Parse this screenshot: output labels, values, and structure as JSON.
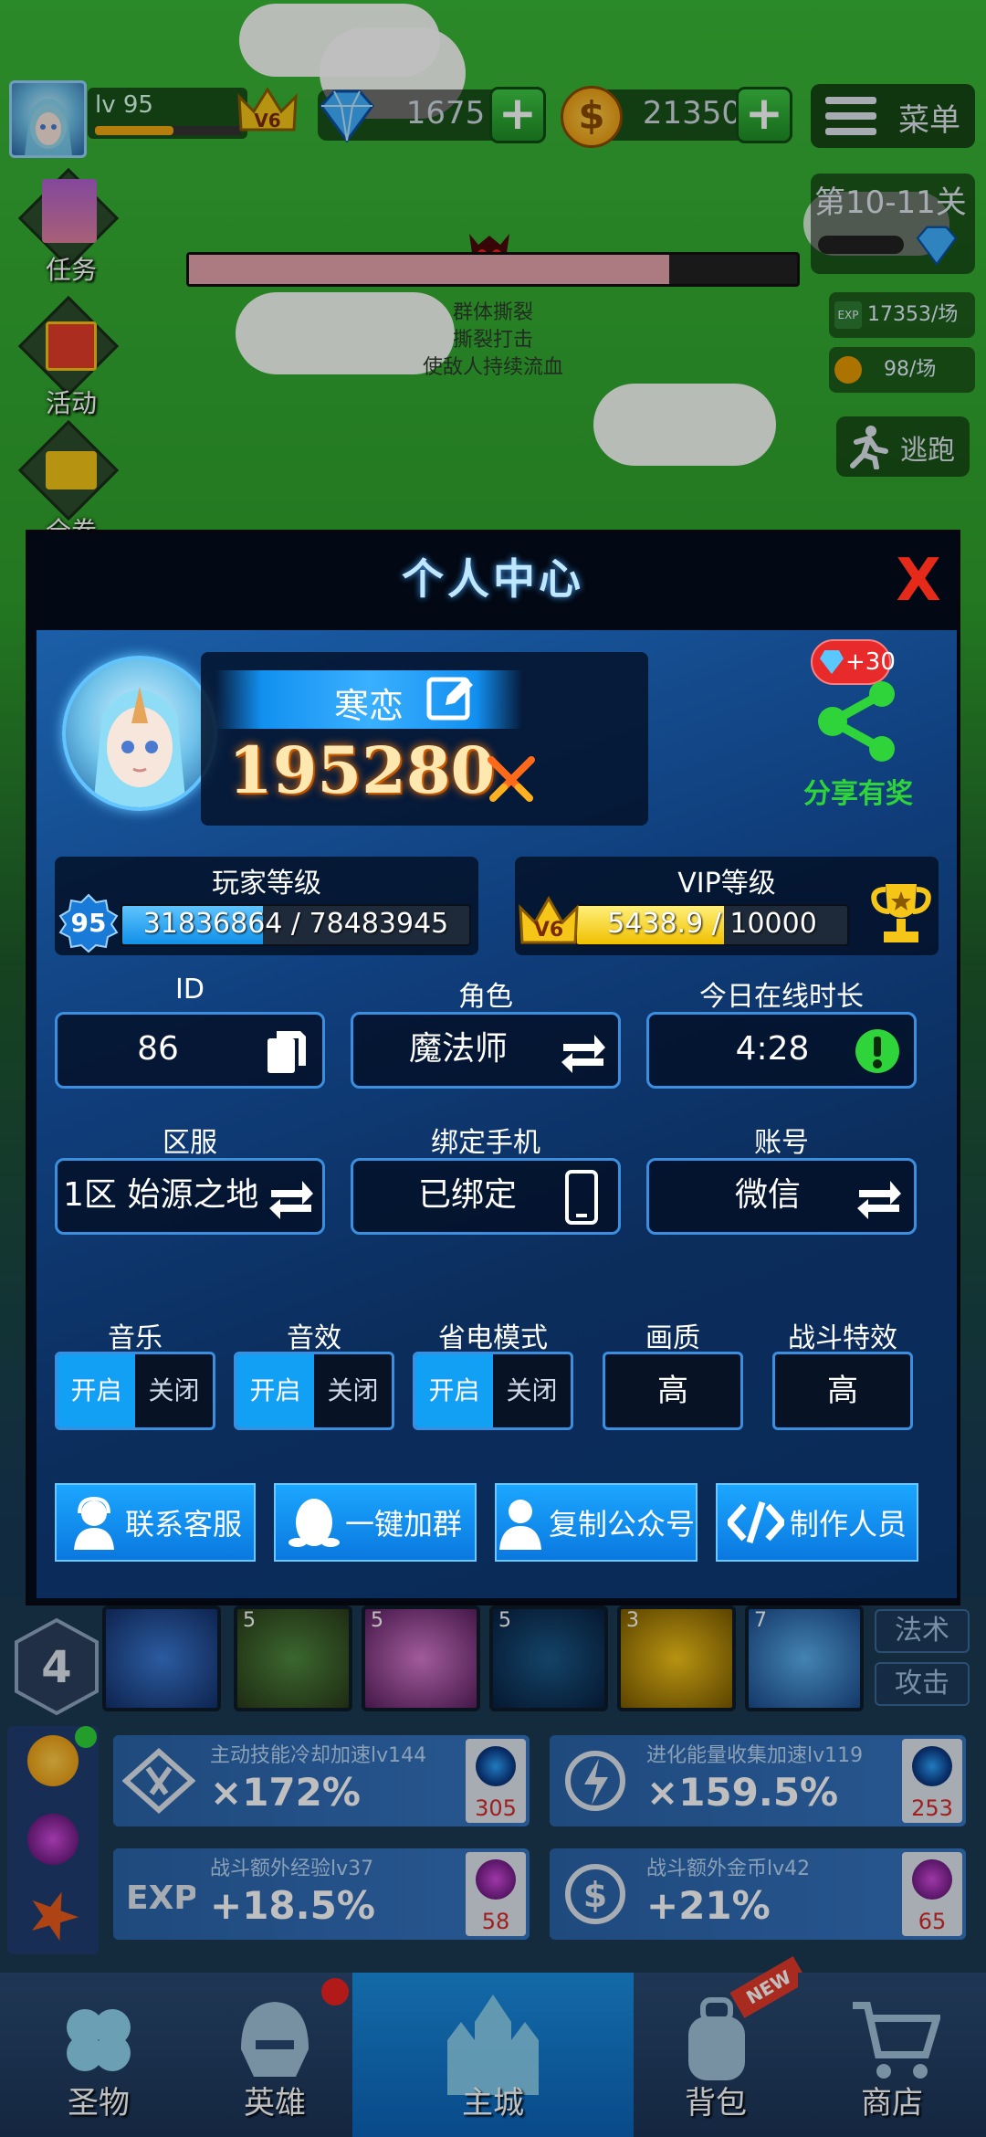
{
  "top": {
    "player_level": "lv 95",
    "vip_badge": "V6",
    "diamonds": "1675",
    "gold": "21350",
    "menu_label": "菜单",
    "stage": "第10-11关",
    "exp_rate": "17353/场",
    "gold_rate": "98/场",
    "escape_label": "逃跑",
    "skill_lines": [
      "群体撕裂",
      "撕裂打击",
      "使敌人持续流血"
    ],
    "boss_hp_fraction": 0.79
  },
  "side": {
    "items": [
      {
        "label": "任务",
        "icon": "task-icon"
      },
      {
        "label": "活动",
        "icon": "gift-icon"
      },
      {
        "label": "全卷",
        "icon": "coupon-icon"
      }
    ]
  },
  "modal": {
    "title": "个人中心",
    "close": "X",
    "name": "寒恋",
    "power": "195280",
    "share_reward": "+30",
    "share_label": "分享有奖",
    "player_level_title": "玩家等级",
    "player_level_badge": "95",
    "player_exp": "31836864 / 78483945",
    "player_exp_fraction": 0.405,
    "vip_title": "VIP等级",
    "vip_badge": "V6",
    "vip_points": "5438.9 / 10000",
    "vip_fraction": 0.544,
    "fields": [
      {
        "label": "ID",
        "value": "86",
        "icon": "copy-icon"
      },
      {
        "label": "角色",
        "value": "魔法师",
        "icon": "swap-icon"
      },
      {
        "label": "今日在线时长",
        "value": "4:28",
        "icon": "alert-icon"
      },
      {
        "label": "区服",
        "value": "1区 始源之地",
        "icon": "swap-icon"
      },
      {
        "label": "绑定手机",
        "value": "已绑定",
        "icon": "phone-icon"
      },
      {
        "label": "账号",
        "value": "微信",
        "icon": "swap-icon"
      }
    ],
    "settings": {
      "music": "音乐",
      "sfx": "音效",
      "power_save": "省电模式",
      "quality": "画质",
      "battle_fx": "战斗特效",
      "on": "开启",
      "off": "关闭",
      "quality_value": "高",
      "battle_fx_value": "高"
    },
    "actions": [
      "联系客服",
      "一键加群",
      "复制公众号",
      "制作人员"
    ]
  },
  "bottom": {
    "skill_level": "4",
    "slot_levels": [
      "",
      "5",
      "5",
      "5",
      "3",
      "7"
    ],
    "tabs": [
      "法术",
      "攻击"
    ],
    "cards": [
      {
        "title": "主动技能冷却加速lv144",
        "value": "×172%",
        "cost": "305"
      },
      {
        "title": "进化能量收集加速lv119",
        "value": "×159.5%",
        "cost": "253"
      },
      {
        "title": "战斗额外经验lv37",
        "value": "+18.5%",
        "cost": "58"
      },
      {
        "title": "战斗额外金币lv42",
        "value": "+21%",
        "cost": "65"
      }
    ],
    "nav": [
      "圣物",
      "英雄",
      "主城",
      "背包",
      "商店"
    ],
    "new_badge": "NEW"
  },
  "colors": {
    "accent": "#12a0f5",
    "close": "#e62a1a",
    "gold": "#f5c518",
    "share": "#2fd33a"
  }
}
